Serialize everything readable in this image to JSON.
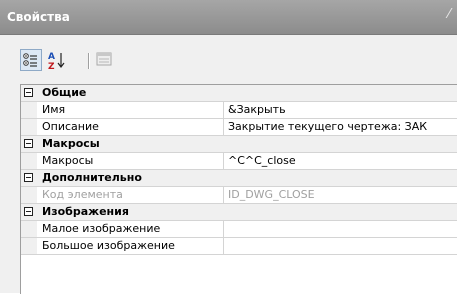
{
  "window": {
    "title": "Свойства"
  },
  "toolbar": {
    "buttons": [
      {
        "icon": "categorized-icon",
        "active": true
      },
      {
        "icon": "sort-az-icon",
        "active": false
      },
      {
        "icon": "property-pages-icon",
        "active": false
      }
    ]
  },
  "grid": {
    "categories": [
      {
        "label": "Общие",
        "rows": [
          {
            "name": "Имя",
            "value": "&Закрыть",
            "disabled": false
          },
          {
            "name": "Описание",
            "value": "Закрытие текущего чертежа:  ЗАК",
            "disabled": false
          }
        ]
      },
      {
        "label": "Макросы",
        "rows": [
          {
            "name": "Макросы",
            "value": "^C^C_close",
            "disabled": false
          }
        ]
      },
      {
        "label": "Дополнительно",
        "rows": [
          {
            "name": "Код элемента",
            "value": "ID_DWG_CLOSE",
            "disabled": true
          }
        ]
      },
      {
        "label": "Изображения",
        "rows": [
          {
            "name": "Малое изображение",
            "value": "",
            "disabled": false
          },
          {
            "name": "Большое изображение",
            "value": "",
            "disabled": false
          }
        ]
      }
    ]
  },
  "colors": {
    "titlebar": "#999999",
    "panel": "#f0f0f0",
    "disabled_text": "#a0a0a0"
  }
}
